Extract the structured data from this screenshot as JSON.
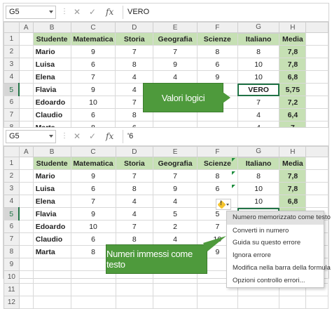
{
  "colors": {
    "header_green": "#c6e0b4",
    "accent": "#217346",
    "callout_green": "#4e9a3c",
    "warning": "#f4c430"
  },
  "columns": [
    "A",
    "B",
    "C",
    "D",
    "E",
    "F",
    "G",
    "H"
  ],
  "rows": [
    "1",
    "2",
    "3",
    "4",
    "5",
    "6",
    "7",
    "8",
    "9",
    "10",
    "11",
    "12"
  ],
  "headers": [
    "Studente",
    "Matematica",
    "Storia",
    "Geografia",
    "Scienze",
    "Italiano",
    "Media"
  ],
  "top": {
    "namebox": "G5",
    "formula": "VERO",
    "icons": [
      "cancel-icon",
      "enter-icon",
      "function-icon"
    ],
    "data": [
      [
        "Mario",
        "9",
        "7",
        "7",
        "8",
        "8",
        "7,8"
      ],
      [
        "Luisa",
        "6",
        "8",
        "9",
        "6",
        "10",
        "7,8"
      ],
      [
        "Elena",
        "7",
        "4",
        "4",
        "9",
        "10",
        "6,8"
      ],
      [
        "Flavia",
        "9",
        "4",
        "5",
        "5",
        "VERO",
        "5,75"
      ],
      [
        "Edoardo",
        "10",
        "7",
        "",
        "",
        "7",
        "7,2"
      ],
      [
        "Claudio",
        "6",
        "8",
        "",
        "",
        "4",
        "6,4"
      ],
      [
        "Marta",
        "8",
        "6",
        "",
        "",
        "4",
        "7"
      ]
    ],
    "callout": "Valori logici"
  },
  "bottom": {
    "namebox": "G5",
    "formula": "'6",
    "data": [
      [
        "Mario",
        "9",
        "7",
        "7",
        "8",
        "8",
        "7,8"
      ],
      [
        "Luisa",
        "6",
        "8",
        "9",
        "6",
        "10",
        "7,8"
      ],
      [
        "Elena",
        "7",
        "4",
        "4",
        "9",
        "10",
        "6,8"
      ],
      [
        "Flavia",
        "9",
        "4",
        "5",
        "5",
        "6",
        "5,75"
      ],
      [
        "Edoardo",
        "10",
        "7",
        "2",
        "7",
        "",
        ""
      ],
      [
        "Claudio",
        "6",
        "8",
        "4",
        "10",
        "",
        ""
      ],
      [
        "Marta",
        "8",
        "6",
        "8",
        "9",
        "",
        ""
      ]
    ],
    "callout": "Numeri immessi come testo",
    "menu": [
      "Numero memorizzato come testo",
      "Converti in numero",
      "Guida su questo errore",
      "Ignora errore",
      "Modifica nella barra della formula",
      "Opzioni controllo errori..."
    ]
  }
}
